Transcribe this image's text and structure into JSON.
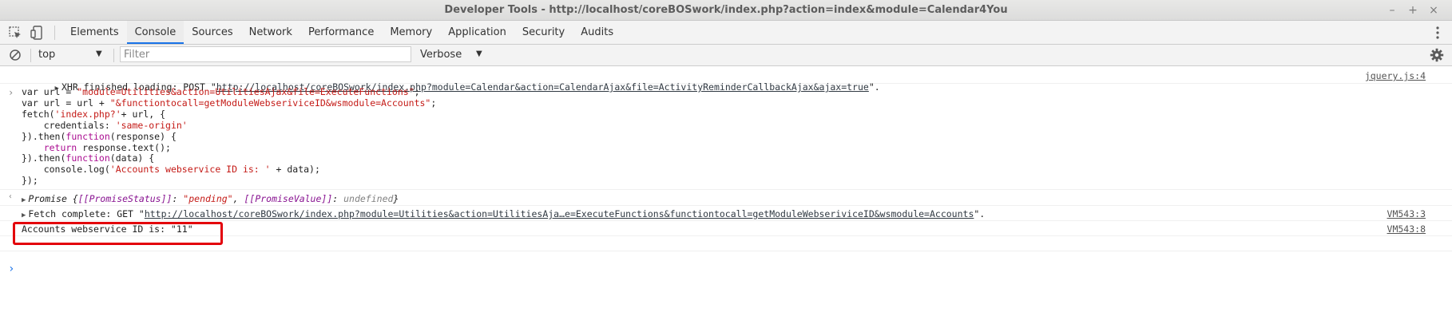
{
  "window": {
    "title": "Developer Tools - http://localhost/coreBOSwork/index.php?action=index&module=Calendar4You",
    "controls": [
      "–",
      "+",
      "×"
    ]
  },
  "toolbar": {
    "inspect_icon": "inspect-element-icon",
    "device_icon": "device-toolbar-icon",
    "tabs": [
      {
        "label": "Elements",
        "active": false
      },
      {
        "label": "Console",
        "active": true
      },
      {
        "label": "Sources",
        "active": false
      },
      {
        "label": "Network",
        "active": false
      },
      {
        "label": "Performance",
        "active": false
      },
      {
        "label": "Memory",
        "active": false
      },
      {
        "label": "Application",
        "active": false
      },
      {
        "label": "Security",
        "active": false
      },
      {
        "label": "Audits",
        "active": false
      }
    ],
    "menu_icon": "kebab-menu-icon"
  },
  "filterbar": {
    "clear_icon": "clear-console-icon",
    "context": "top",
    "filter_placeholder": "Filter",
    "level": "Verbose",
    "settings_icon": "gear-icon"
  },
  "console": {
    "xhr": {
      "prefix": "XHR finished loading: POST \"",
      "url": "http://localhost/coreBOSwork/index.php?module=Calendar&action=CalendarAjax&file=ActivityReminderCallbackAjax&ajax=true",
      "suffix": "\".",
      "source": "jquery.js:4"
    },
    "code": {
      "l1_a": "var url = ",
      "l1_b": "\"module=Utilities&action=UtilitiesAjax&file=ExecuteFunctions\"",
      "l1_c": ";",
      "l2_a": "var url = url + ",
      "l2_b": "\"&functiontocall=getModuleWebseriviceID&wsmodule=Accounts\"",
      "l2_c": ";",
      "l3_a": "fetch(",
      "l3_b": "'index.php?'",
      "l3_c": "+ url, {",
      "l4_a": "    credentials: ",
      "l4_b": "'same-origin'",
      "l5_a": "}).then(",
      "l5_b": "function",
      "l5_c": "(response) {",
      "l6_a": "    return",
      "l6_b": " response.text();",
      "l7_a": "}).then(",
      "l7_b": "function",
      "l7_c": "(data) {",
      "l8_a": "    console.log(",
      "l8_b": "'Accounts webservice ID is: '",
      "l8_c": " + data);",
      "l9": "});"
    },
    "promise": {
      "label": "Promise {",
      "status_key": "[[PromiseStatus]]",
      "status_val": "\"pending\"",
      "value_key": "[[PromiseValue]]",
      "value_val": "undefined",
      "close": "}"
    },
    "fetch": {
      "prefix": "Fetch complete: GET \"",
      "url": "http://localhost/coreBOSwork/index.php?module=Utilities&action=UtilitiesAja…e=ExecuteFunctions&functiontocall=getModuleWebseriviceID&wsmodule=Accounts",
      "suffix": "\".",
      "source": "VM543:3"
    },
    "log": {
      "text": "Accounts webservice ID is: \"11\"",
      "source": "VM543:8"
    }
  },
  "colors": {
    "highlight_border": "#e3000b",
    "active_tab_underline": "#1a73e8",
    "string": "#c41a16",
    "keyword": "#aa0d91"
  }
}
